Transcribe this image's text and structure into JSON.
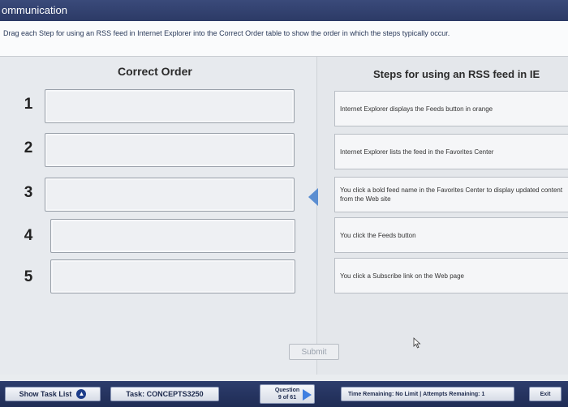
{
  "window": {
    "title": "ommunication"
  },
  "instruction": "Drag each Step for using an RSS feed in Internet Explorer into the Correct Order table to show the order in which the steps typically occur.",
  "left_header": "Correct Order",
  "right_header": "Steps for using an RSS feed in IE",
  "slots": [
    {
      "number": "1"
    },
    {
      "number": "2"
    },
    {
      "number": "3"
    },
    {
      "number": "4"
    },
    {
      "number": "5"
    }
  ],
  "steps": [
    {
      "text": "Internet Explorer displays the Feeds button in orange"
    },
    {
      "text": "Internet Explorer lists the feed in the Favorites Center"
    },
    {
      "text": "You click a bold feed name in the Favorites Center to display updated content from the Web site"
    },
    {
      "text": "You click the Feeds button"
    },
    {
      "text": "You click a Subscribe link on the Web page"
    }
  ],
  "submit_label": "Submit",
  "bottom": {
    "show_task_list": "Show Task List",
    "task": "Task: CONCEPTS3250",
    "question_label": "Question",
    "question_count": "9 of 61",
    "time_remaining_label": "Time Remaining:",
    "time_remaining_value": "No Limit",
    "attempts_label": "Attempts Remaining:",
    "attempts_value": "1",
    "exit_label": "Exit"
  },
  "colors": {
    "accent": "#5b8ed1",
    "bar": "#2d3d6c"
  }
}
